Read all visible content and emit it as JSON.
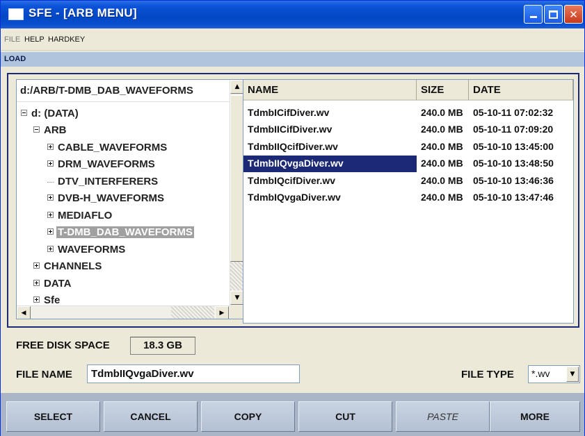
{
  "window": {
    "title": "SFE - [ARB MENU]"
  },
  "menu": {
    "items": [
      "FILE",
      "HELP",
      "HARDKEY"
    ]
  },
  "section_label": "LOAD",
  "tree": {
    "path": "d:/ARB/T-DMB_DAB_WAVEFORMS",
    "items": [
      {
        "label": "d: (DATA)",
        "toggle": "minus"
      },
      {
        "label": "ARB",
        "toggle": "minus"
      },
      {
        "label": "CABLE_WAVEFORMS",
        "toggle": "plus"
      },
      {
        "label": "DRM_WAVEFORMS",
        "toggle": "plus"
      },
      {
        "label": "DTV_INTERFERERS",
        "toggle": "none"
      },
      {
        "label": "DVB-H_WAVEFORMS",
        "toggle": "plus"
      },
      {
        "label": "MEDIAFLO",
        "toggle": "plus"
      },
      {
        "label": "T-DMB_DAB_WAVEFORMS",
        "toggle": "plus",
        "selected": true
      },
      {
        "label": "WAVEFORMS",
        "toggle": "plus"
      },
      {
        "label": "CHANNELS",
        "toggle": "plus"
      },
      {
        "label": "DATA",
        "toggle": "plus"
      },
      {
        "label": "Sfe",
        "toggle": "plus"
      }
    ]
  },
  "files": {
    "columns": [
      "NAME",
      "SIZE",
      "DATE"
    ],
    "rows": [
      {
        "name": "TdmbICifDiver.wv",
        "size": "240.0 MB",
        "date": "05-10-11 07:02:32"
      },
      {
        "name": "TdmbIICifDiver.wv",
        "size": "240.0 MB",
        "date": "05-10-11 07:09:20"
      },
      {
        "name": "TdmbIIQcifDiver.wv",
        "size": "240.0 MB",
        "date": "05-10-10 13:45:00"
      },
      {
        "name": "TdmbIIQvgaDiver.wv",
        "size": "240.0 MB",
        "date": "05-10-10 13:48:50",
        "selected": true
      },
      {
        "name": "TdmbIQcifDiver.wv",
        "size": "240.0 MB",
        "date": "05-10-10 13:46:36"
      },
      {
        "name": "TdmbIQvgaDiver.wv",
        "size": "240.0 MB",
        "date": "05-10-10 13:47:46"
      }
    ]
  },
  "disk": {
    "label": "FREE DISK SPACE",
    "value": "18.3 GB"
  },
  "filename": {
    "label": "FILE NAME",
    "value": "TdmbIIQvgaDiver.wv"
  },
  "filetype": {
    "label": "FILE TYPE",
    "value": "*.wv"
  },
  "buttons": {
    "select": "SELECT",
    "cancel": "CANCEL",
    "copy": "COPY",
    "cut": "CUT",
    "paste": "PASTE",
    "more": "MORE"
  },
  "icons": {
    "scroll_up": "▲",
    "scroll_down": "▼",
    "scroll_left": "◀",
    "scroll_right": "▶",
    "dropdown": "▼",
    "minimize": "",
    "maximize": "",
    "close": "✕"
  },
  "colors": {
    "title_bar": "#0247c4",
    "selection": "#1c2a75",
    "section_bar": "#b0c4de",
    "button_bar": "#aab6c8"
  }
}
